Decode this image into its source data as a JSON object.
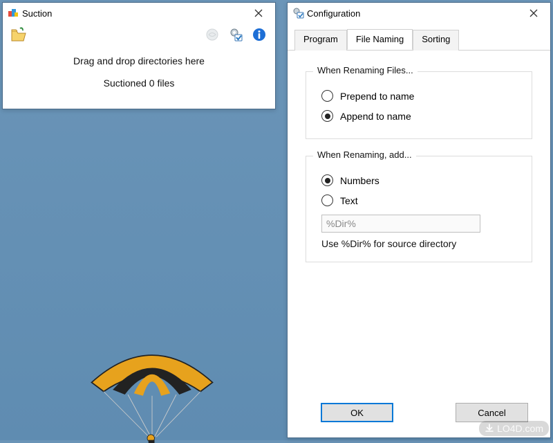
{
  "main_window": {
    "title": "Suction",
    "drop_message": "Drag and drop directories here",
    "status": "Suctioned 0 files"
  },
  "config_window": {
    "title": "Configuration",
    "tabs": [
      {
        "label": "Program",
        "active": false
      },
      {
        "label": "File Naming",
        "active": true
      },
      {
        "label": "Sorting",
        "active": false
      }
    ],
    "group_rename_files": {
      "legend": "When Renaming Files...",
      "options": [
        {
          "label": "Prepend to name",
          "checked": false
        },
        {
          "label": "Append to name",
          "checked": true
        }
      ]
    },
    "group_rename_add": {
      "legend": "When Renaming, add...",
      "options": [
        {
          "label": "Numbers",
          "checked": true
        },
        {
          "label": "Text",
          "checked": false
        }
      ],
      "text_value": "%Dir%",
      "hint": "Use %Dir% for source directory"
    },
    "ok_label": "OK",
    "cancel_label": "Cancel"
  },
  "watermark": "LO4D.com",
  "colors": {
    "desktop": "#6a94b7",
    "accent": "#0078d7"
  }
}
